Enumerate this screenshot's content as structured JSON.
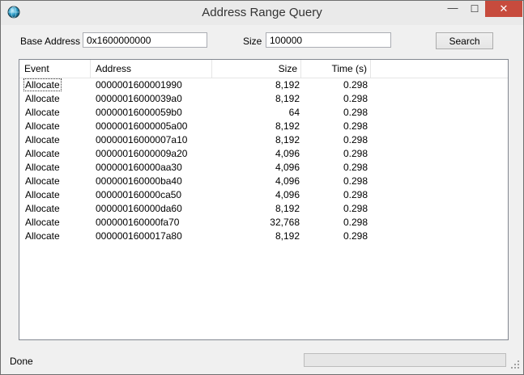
{
  "window": {
    "title": "Address Range Query"
  },
  "query": {
    "base_label": "Base Address",
    "base_value": "0x1600000000",
    "size_label": "Size",
    "size_value": "100000",
    "search_label": "Search"
  },
  "table": {
    "headers": [
      "Event",
      "Address",
      "Size",
      "Time (s)"
    ],
    "rows": [
      {
        "event": "Allocate",
        "address": "0000001600001990",
        "size": "8,192",
        "time": "0.298"
      },
      {
        "event": "Allocate",
        "address": "00000016000039a0",
        "size": "8,192",
        "time": "0.298"
      },
      {
        "event": "Allocate",
        "address": "00000016000059b0",
        "size": "64",
        "time": "0.298"
      },
      {
        "event": "Allocate",
        "address": "00000016000005a00",
        "size": "8,192",
        "time": "0.298"
      },
      {
        "event": "Allocate",
        "address": "00000016000007a10",
        "size": "8,192",
        "time": "0.298"
      },
      {
        "event": "Allocate",
        "address": "00000016000009a20",
        "size": "4,096",
        "time": "0.298"
      },
      {
        "event": "Allocate",
        "address": "000000160000aa30",
        "size": "4,096",
        "time": "0.298"
      },
      {
        "event": "Allocate",
        "address": "000000160000ba40",
        "size": "4,096",
        "time": "0.298"
      },
      {
        "event": "Allocate",
        "address": "000000160000ca50",
        "size": "4,096",
        "time": "0.298"
      },
      {
        "event": "Allocate",
        "address": "000000160000da60",
        "size": "8,192",
        "time": "0.298"
      },
      {
        "event": "Allocate",
        "address": "000000160000fa70",
        "size": "32,768",
        "time": "0.298"
      },
      {
        "event": "Allocate",
        "address": "0000001600017a80",
        "size": "8,192",
        "time": "0.298"
      }
    ]
  },
  "status": {
    "text": "Done",
    "progress": 0
  },
  "colors": {
    "close_button": "#c74b3d",
    "progress_fill": "#06b025"
  },
  "icons": [
    "app-globe-icon",
    "minimize-icon",
    "maximize-icon",
    "close-icon",
    "resize-grip-icon"
  ]
}
